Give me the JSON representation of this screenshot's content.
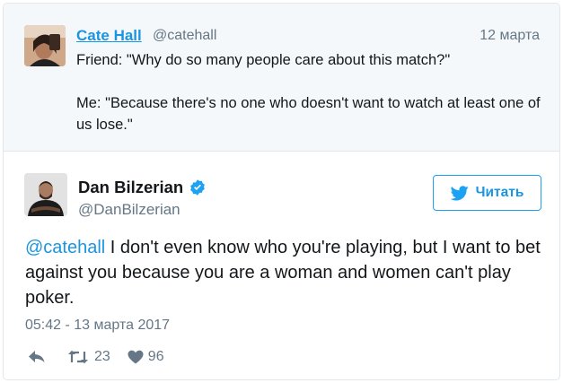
{
  "parent_tweet": {
    "author_name": "Cate Hall",
    "author_handle": "@catehall",
    "date": "12 марта",
    "text_lines": [
      "Friend: \"Why do so many people care about this match?\"",
      "Me: \"Because there's no one who doesn't want to watch at least one of us lose.\""
    ]
  },
  "tweet": {
    "author_name": "Dan Bilzerian",
    "author_handle": "@DanBilzerian",
    "verified_icon": "verified-badge-icon",
    "mention": "@catehall",
    "text_rest": " I don't even know who you're playing, but I want to bet against you because you are a woman and women can't play poker.",
    "timestamp": "05:42 - 13 марта 2017",
    "follow_label": "Читать",
    "retweets": "23",
    "likes": "96"
  },
  "colors": {
    "link": "#1b95e0",
    "muted": "#657786",
    "verified": "#1da1f2",
    "parent_bg": "#f5f8fa"
  }
}
